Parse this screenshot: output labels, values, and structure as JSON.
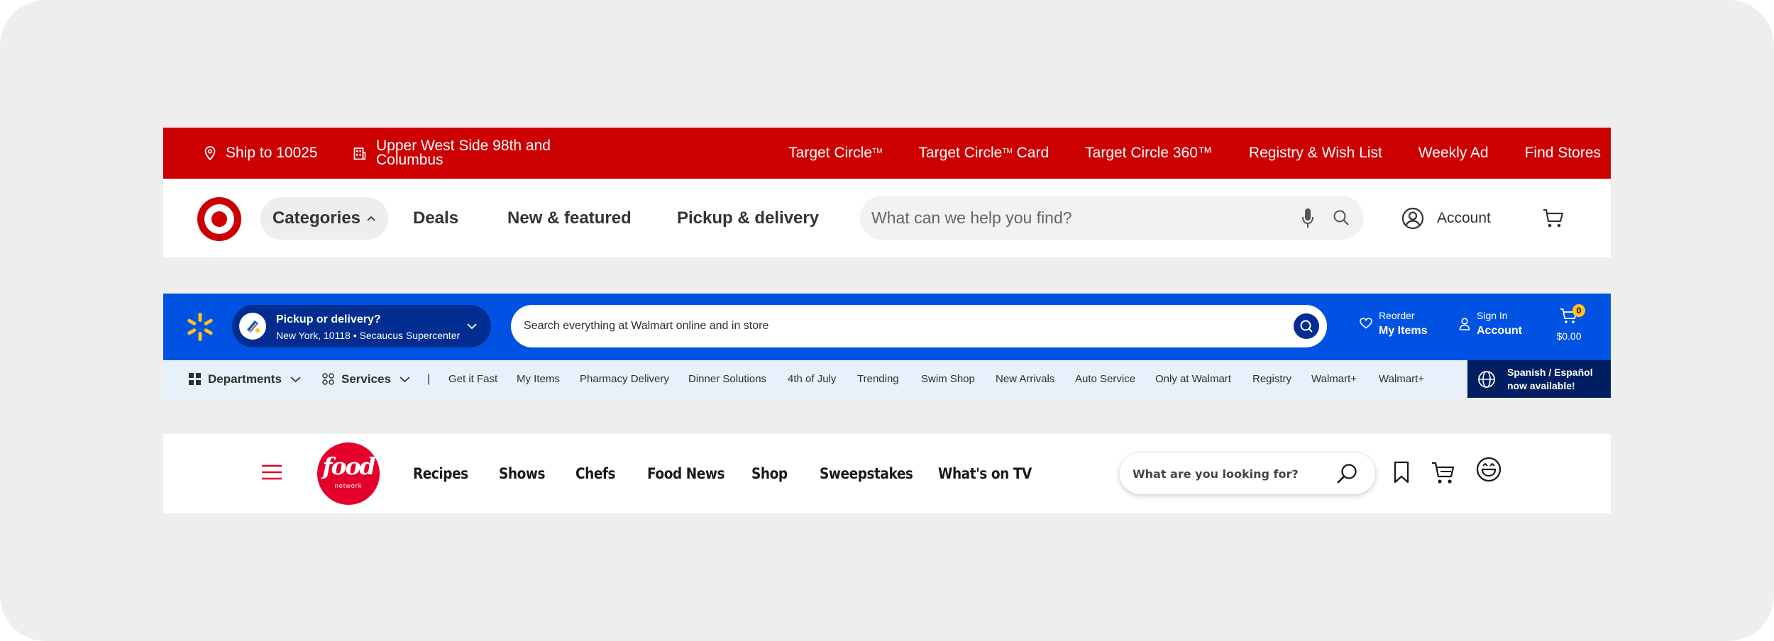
{
  "target": {
    "ship_to": "Ship to 10025",
    "store": "Upper West Side 98th and Columbus",
    "top_links": [
      {
        "label": "Target Circle",
        "tm": "TM"
      },
      {
        "label": "Target Circle",
        "tm": "TM",
        "suffix": " Card"
      },
      {
        "label": "Target Circle 360™"
      },
      {
        "label": "Registry & Wish List"
      },
      {
        "label": "Weekly Ad"
      },
      {
        "label": "Find Stores"
      }
    ],
    "categories": "Categories",
    "nav": [
      "Deals",
      "New & featured",
      "Pickup & delivery"
    ],
    "search_placeholder": "What can we help you find?",
    "account": "Account",
    "brand_color": "#cc0000",
    "icons": [
      "location-pin-icon",
      "store-icon",
      "bullseye-logo",
      "chevron-up-icon",
      "microphone-icon",
      "search-icon",
      "user-circle-icon",
      "cart-icon"
    ]
  },
  "walmart": {
    "pickup_title": "Pickup or delivery?",
    "pickup_sub": "New York, 10118 • Secaucus Supercenter",
    "search_placeholder": "Search everything at Walmart online and in store",
    "reorder_small": "Reorder",
    "reorder_big": "My Items",
    "signin_small": "Sign In",
    "signin_big": "Account",
    "cart_count": "0",
    "cart_total": "$0.00",
    "departments": "Departments",
    "services": "Services",
    "divider": "|",
    "subnav": [
      "Get it Fast",
      "My Items",
      "Pharmacy Delivery",
      "Dinner Solutions",
      "4th of July",
      "Trending",
      "Swim Shop",
      "New Arrivals",
      "Auto Service",
      "Only at Walmart",
      "Registry",
      "Walmart+",
      "Walmart+"
    ],
    "spanish_line1": "Spanish / Español",
    "spanish_line2": "now available!",
    "brand_color": "#0053e2",
    "accent_color": "#ffc220",
    "icons": [
      "spark-logo",
      "delivery-icon",
      "chevron-down-icon",
      "search-icon",
      "heart-icon",
      "user-icon",
      "cart-icon",
      "grid-icon",
      "services-icon",
      "globe-icon"
    ]
  },
  "food": {
    "logo_word": "food",
    "logo_sub": "network",
    "nav": [
      "Recipes",
      "Shows",
      "Chefs",
      "Food News",
      "Shop",
      "Sweepstakes",
      "What's on TV"
    ],
    "search_placeholder": "What are you looking for?",
    "brand_color": "#e4002b",
    "icons": [
      "hamburger-menu-icon",
      "search-icon",
      "bookmark-icon",
      "cart-icon",
      "smiley-profile-icon"
    ]
  }
}
